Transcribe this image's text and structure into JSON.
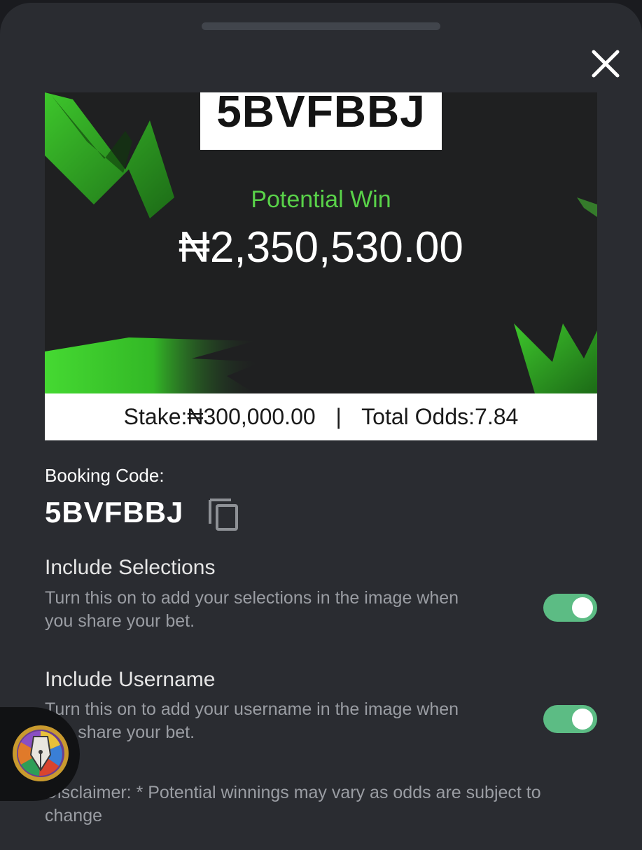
{
  "share_card": {
    "code": "5BVFBBJ",
    "potential_win_label": "Potential Win",
    "potential_win_amount": "₦2,350,530.00",
    "stake_label": "Stake:",
    "stake_value": "₦300,000.00",
    "separator": "|",
    "odds_label": "Total Odds:",
    "odds_value": "7.84"
  },
  "booking": {
    "label": "Booking Code:",
    "code": "5BVFBBJ"
  },
  "options": [
    {
      "title": "Include Selections",
      "description": "Turn this on to add your selections in the image when you share your bet.",
      "enabled": true
    },
    {
      "title": "Include Username",
      "description": "Turn this on to add your username in the image when you share your bet.",
      "enabled": true
    }
  ],
  "disclaimer": "Disclaimer: * Potential winnings may vary as odds are subject to change",
  "colors": {
    "accent_green": "#59d249",
    "toggle_on": "#5cbc84",
    "sheet_bg": "#2a2c31"
  },
  "icons": [
    "close-icon",
    "copy-icon",
    "pen-badge-icon"
  ]
}
